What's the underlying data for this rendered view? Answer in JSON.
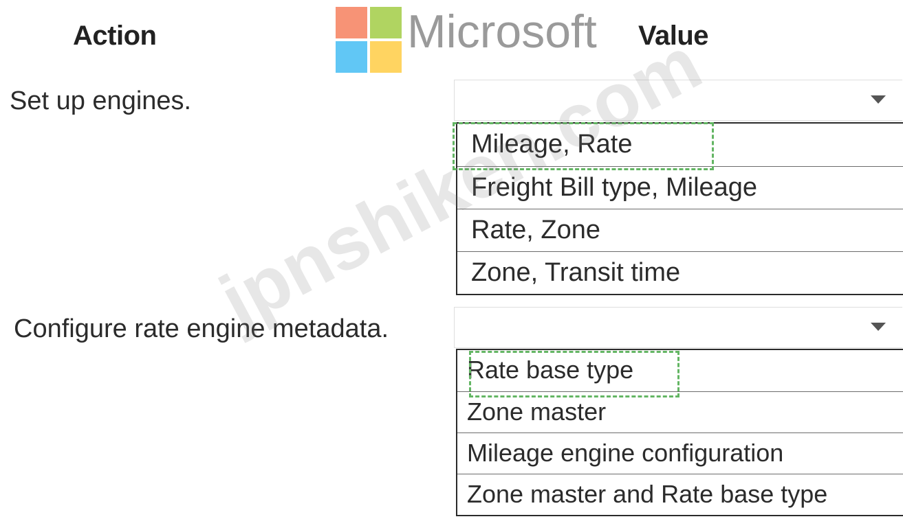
{
  "header": {
    "action_label": "Action",
    "value_label": "Value"
  },
  "watermark": {
    "logo_word": "Microsoft",
    "logo_icon": "microsoft-logo-icon",
    "site_text": "jpnshiken.com"
  },
  "rows": [
    {
      "action": "Set up engines.",
      "dropdown_value": "",
      "dropdown_icon": "chevron-down-icon",
      "options": [
        "Mileage, Rate",
        "Freight Bill type, Mileage",
        "Rate, Zone",
        "Zone, Transit time"
      ],
      "selected_index": 0
    },
    {
      "action": "Configure rate engine metadata.",
      "dropdown_value": "",
      "dropdown_icon": "chevron-down-icon",
      "options": [
        "Rate base type",
        "Zone master",
        "Mileage engine configuration",
        "Zone master and Rate base type"
      ],
      "selected_index": 0
    }
  ],
  "colors": {
    "selection_frame": "#63b563",
    "text": "#2b2b2b",
    "border": "#2a2a2a"
  }
}
